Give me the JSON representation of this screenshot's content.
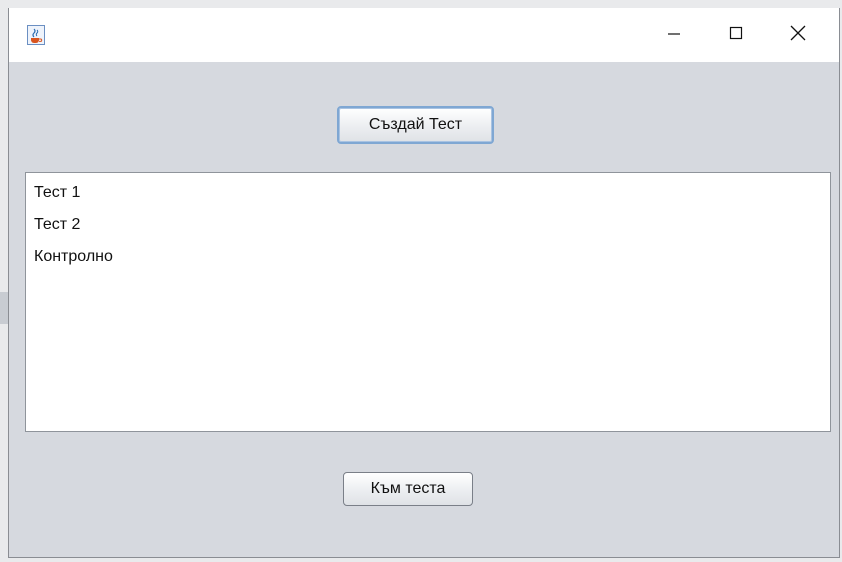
{
  "window": {
    "title": "",
    "app_icon": "java-cup-icon",
    "controls": {
      "minimize_icon": "minimize-icon",
      "maximize_icon": "maximize-icon",
      "close_icon": "close-icon"
    }
  },
  "main": {
    "create_test_label": "Създай Тест",
    "tests_list": {
      "items": [
        {
          "label": "Тест 1"
        },
        {
          "label": "Тест 2"
        },
        {
          "label": "Контролно"
        }
      ]
    },
    "go_to_test_label": "Към теста"
  },
  "colors": {
    "window_bg": "#d6d9df",
    "titlebar_bg": "#ffffff",
    "focus_border": "#7fa7d3"
  }
}
